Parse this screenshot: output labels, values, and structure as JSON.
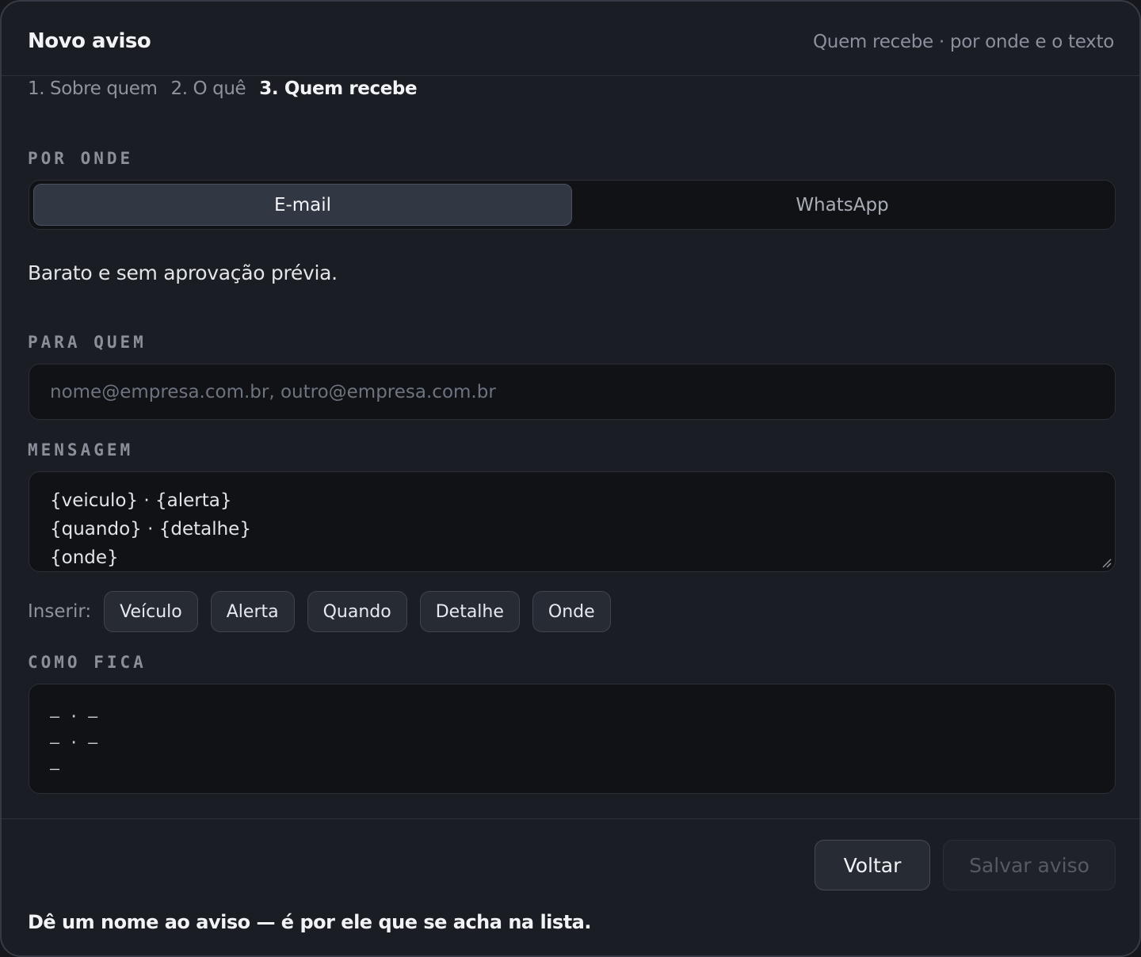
{
  "header": {
    "title": "Novo aviso",
    "subtitle": "Quem recebe · por onde e o texto"
  },
  "steps": [
    {
      "label": "1. Sobre quem",
      "active": false
    },
    {
      "label": "2. O quê",
      "active": false
    },
    {
      "label": "3. Quem recebe",
      "active": true
    }
  ],
  "channel": {
    "label": "POR ONDE",
    "options": [
      "E-mail",
      "WhatsApp"
    ],
    "selected": "E-mail",
    "hint": "Barato e sem aprovação prévia."
  },
  "recipients": {
    "label": "PARA QUEM",
    "value": "",
    "placeholder": "nome@empresa.com.br, outro@empresa.com.br"
  },
  "message": {
    "label": "MENSAGEM",
    "lines": [
      "{veiculo} · {alerta}",
      "{quando} · {detalhe}",
      "{onde}"
    ]
  },
  "insert": {
    "label": "Inserir:",
    "chips": [
      "Veículo",
      "Alerta",
      "Quando",
      "Detalhe",
      "Onde"
    ]
  },
  "preview": {
    "label": "COMO FICA",
    "lines": [
      "— · —",
      "— · —",
      "—"
    ]
  },
  "footer": {
    "back_label": "Voltar",
    "save_label": "Salvar aviso",
    "save_enabled": false,
    "note": "Dê um nome ao aviso — é por ele que se acha na lista."
  }
}
